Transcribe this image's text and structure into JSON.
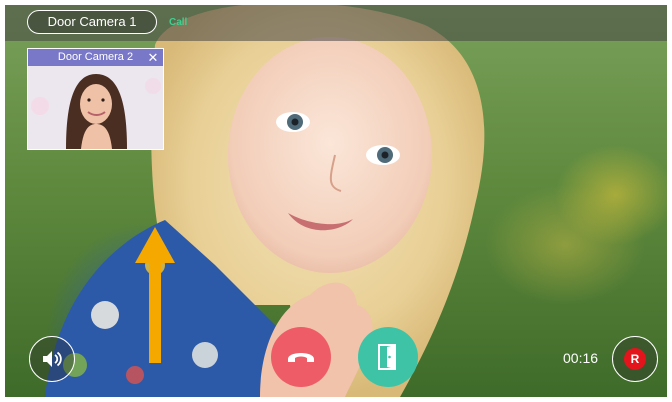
{
  "top_bar": {
    "camera_label": "Door Camera 1",
    "call_label": "Call"
  },
  "pip": {
    "title": "Door Camera 2",
    "close_icon": "close-icon"
  },
  "controls": {
    "speaker_icon": "speaker-icon",
    "end_call_icon": "hang-up-icon",
    "door_icon": "door-open-icon",
    "timer": "00:16",
    "record_label": "R"
  },
  "colors": {
    "call_green": "#3fcf8f",
    "pip_header": "#7877c8",
    "end_call": "#ee5d67",
    "door_open": "#3fc3a6",
    "record": "#e3141c",
    "arrow": "#f5a800"
  }
}
